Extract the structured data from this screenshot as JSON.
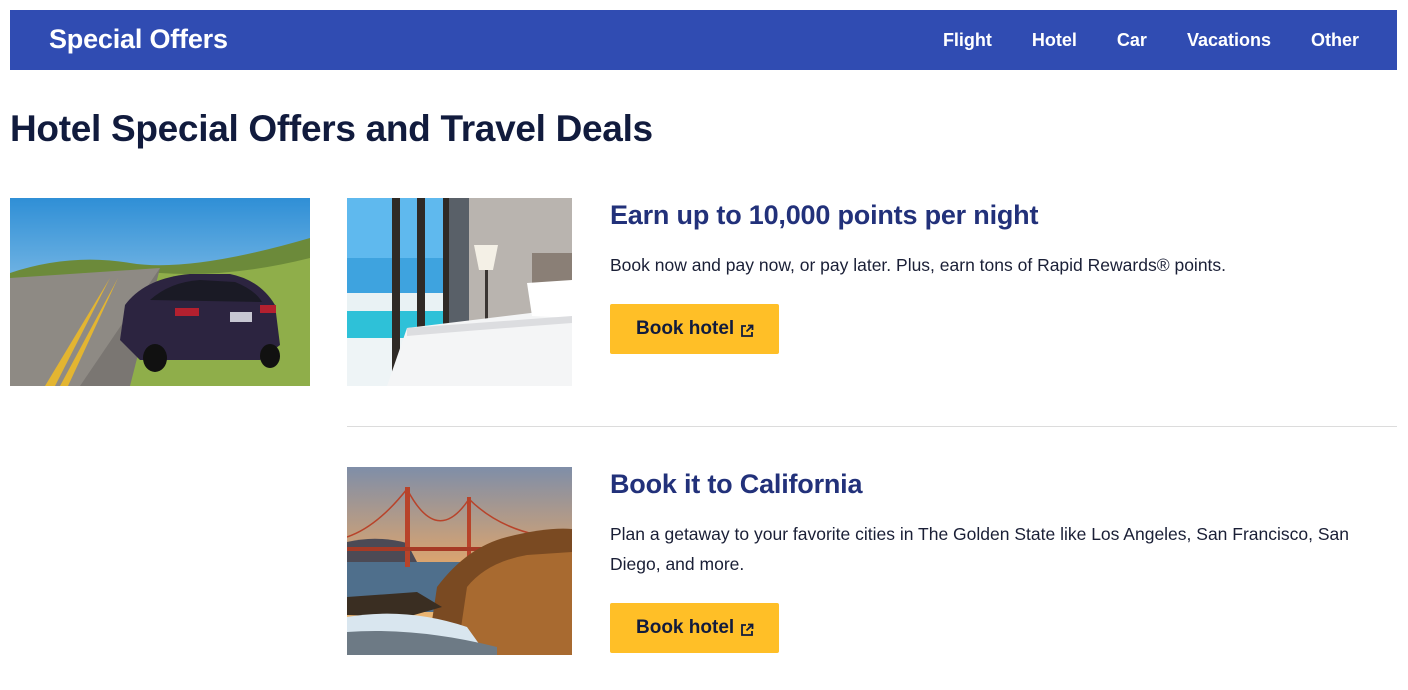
{
  "nav": {
    "brand": "Special Offers",
    "links": [
      "Flight",
      "Hotel",
      "Car",
      "Vacations",
      "Other"
    ]
  },
  "page": {
    "title": "Hotel Special Offers and Travel Deals"
  },
  "offers": [
    {
      "title": "Earn up to 10,000 points per night",
      "description": "Book now and pay now, or pay later. Plus, earn tons of Rapid Rewards® points.",
      "button": "Book hotel",
      "image_icon": "hotel-room-image"
    },
    {
      "title": "Book it to California",
      "description": "Plan a getaway to your favorite cities in The Golden State like Los Angeles, San Francisco, San Diego, and more.",
      "button": "Book hotel",
      "image_icon": "golden-gate-image"
    }
  ],
  "colors": {
    "nav_bg": "#304cb2",
    "button_bg": "#ffbf27",
    "offer_title": "#22317a",
    "page_title": "#111b3d"
  },
  "icons": {
    "button_icon": "external-link-icon",
    "side_image": "car-image"
  }
}
